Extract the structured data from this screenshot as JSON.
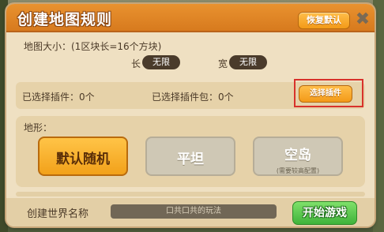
{
  "dialog": {
    "title": "创建地图规则",
    "restore_default_label": "恢复默认",
    "close_icon": "close-icon"
  },
  "map_size": {
    "label": "地图大小：(1区块长=16个方块)",
    "length_label": "长",
    "length_value": "无限",
    "width_label": "宽",
    "width_value": "无限"
  },
  "plugins": {
    "selected_plugins": "已选择插件：0个",
    "selected_packs": "已选择插件包：0个",
    "select_button_label": "选择插件"
  },
  "terrain": {
    "label": "地形：",
    "options": [
      {
        "label": "默认随机",
        "sub": "",
        "selected": true
      },
      {
        "label": "平坦",
        "sub": "",
        "selected": false
      },
      {
        "label": "空岛",
        "sub": "(需要较高配置)",
        "selected": false
      }
    ]
  },
  "footer": {
    "world_name_label": "创建世界名称",
    "world_name_value": "口共口共的玩法",
    "start_button_label": "开始游戏"
  },
  "colors": {
    "title_bar": "#e08626",
    "accent_orange": "#f39a18",
    "start_green": "#3fb33a",
    "highlight_red": "#d8322b"
  }
}
